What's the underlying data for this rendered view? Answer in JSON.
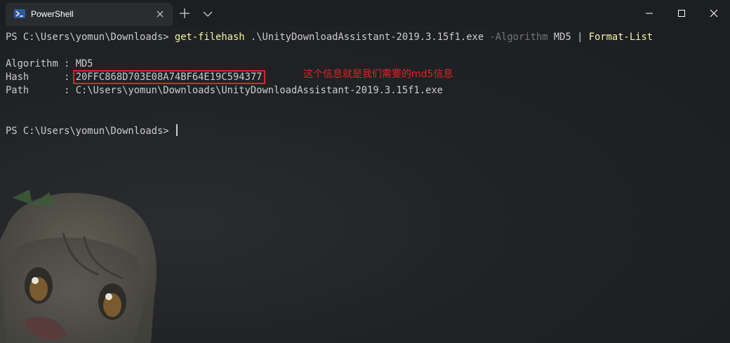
{
  "window": {
    "tab_title": "PowerShell",
    "tab_icon": "powershell-icon",
    "controls": [
      "minimize-icon",
      "maximize-icon",
      "close-icon"
    ]
  },
  "terminal": {
    "prompt1": "PS C:\\Users\\yomun\\Downloads> ",
    "cmd1": "get-filehash",
    "arg1": " .\\UnityDownloadAssistant-2019.3.15f1.exe ",
    "param1": "-Algorithm",
    "arg2": " MD5 | ",
    "cmd2": "Format-List",
    "algorithm_label": "Algorithm : ",
    "algorithm_value": "MD5",
    "hash_label": "Hash      : ",
    "hash_value": "20FFC868D703E08A74BF64E19C594377",
    "path_label": "Path      : ",
    "path_value": "C:\\Users\\yomun\\Downloads\\UnityDownloadAssistant-2019.3.15f1.exe",
    "prompt2": "PS C:\\Users\\yomun\\Downloads> "
  },
  "annotation": {
    "text": "这个信息就是我们需要的md5信息",
    "color": "#e02424"
  },
  "colors": {
    "command": "#f9f1a5",
    "parameter": "#767676",
    "text": "#cccccc",
    "background": "#1f2124"
  }
}
